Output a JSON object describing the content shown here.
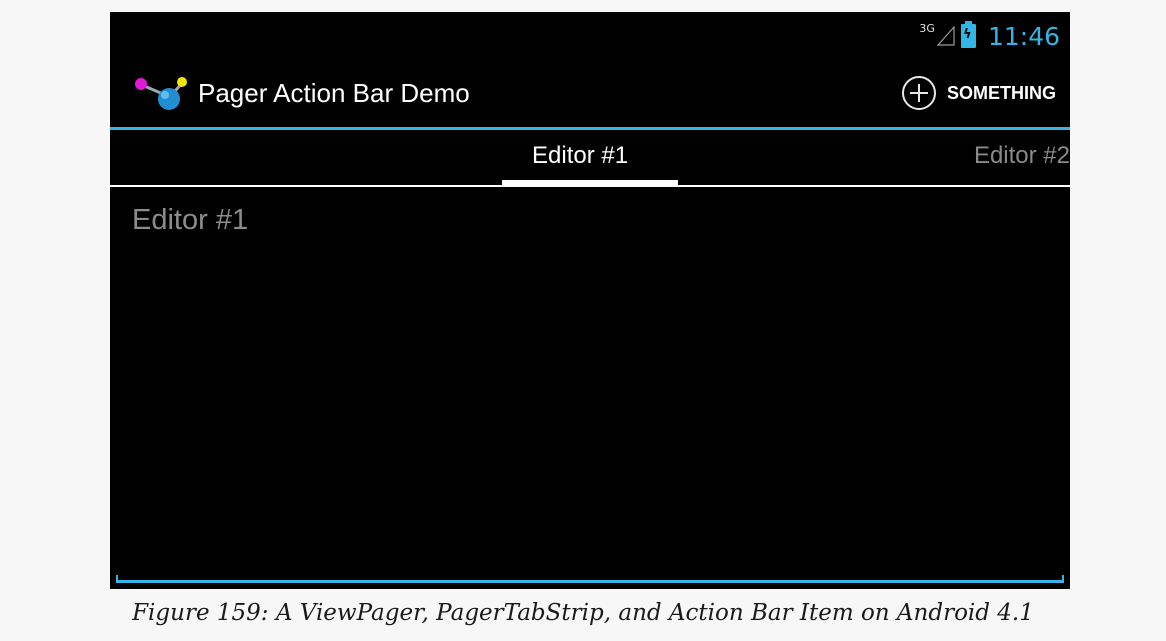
{
  "status_bar": {
    "network_type": "3G",
    "time": "11:46",
    "battery_charging_symbol": "ϟ",
    "icons": [
      "signal-icon",
      "battery-charging-icon"
    ]
  },
  "action_bar": {
    "title": "Pager Action Bar Demo",
    "action_label": "SOMETHING",
    "icons": [
      "app-icon",
      "add-circle-icon"
    ]
  },
  "tabs": [
    {
      "label": "Editor #1",
      "selected": true
    },
    {
      "label": "Editor #2",
      "selected": false
    }
  ],
  "editor": {
    "placeholder": "Editor #1",
    "value": ""
  },
  "caption": "Figure 159: A ViewPager, PagerTabStrip, and Action Bar Item on Android 4.1",
  "colors": {
    "accent": "#33b5e5",
    "background": "#000000",
    "page_background": "#f7f7f7"
  }
}
